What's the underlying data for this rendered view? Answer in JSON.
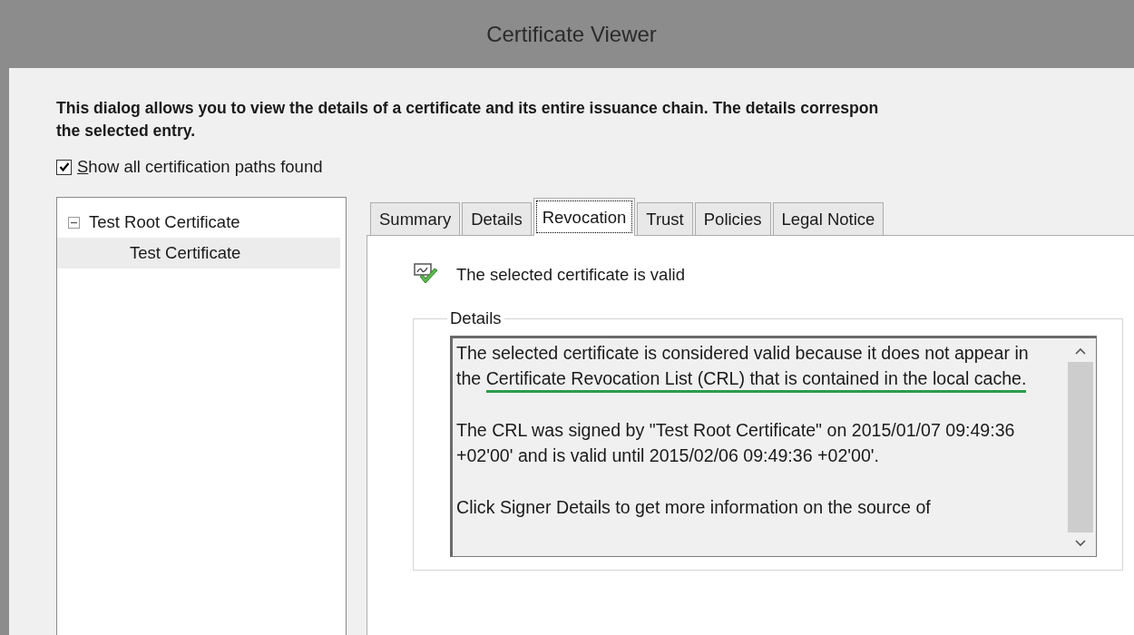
{
  "window": {
    "title": "Certificate Viewer"
  },
  "intro": [
    "This dialog allows you to view the details of a certificate and its entire issuance chain. The details correspon",
    "the selected entry."
  ],
  "show_all_paths": {
    "label": "Show all certification paths found",
    "checked": true
  },
  "tree": [
    {
      "label": "Test Root Certificate",
      "expanded": true,
      "selected": false,
      "children": [
        {
          "label": "Test Certificate",
          "selected": true
        }
      ]
    }
  ],
  "tabs": [
    {
      "label": "Summary",
      "selected": false
    },
    {
      "label": "Details",
      "selected": false
    },
    {
      "label": "Revocation",
      "selected": true
    },
    {
      "label": "Trust",
      "selected": false
    },
    {
      "label": "Policies",
      "selected": false
    },
    {
      "label": "Legal Notice",
      "selected": false
    }
  ],
  "status": {
    "text": "The selected certificate is valid"
  },
  "details": {
    "legend": "Details",
    "paragraphs": [
      {
        "segments": [
          {
            "text": "The selected certificate is considered valid because it does not appear in the ",
            "marked": false
          },
          {
            "text": "Certificate Revocation List (CRL) that is contained in the local cache.",
            "marked": true
          }
        ]
      },
      {
        "segments": [
          {
            "text": "The CRL was signed by \"Test Root Certificate\" on 2015/01/07 09:49:36 +02'00' and is valid until 2015/02/06 09:49:36 +02'00'.",
            "marked": false
          }
        ]
      },
      {
        "segments": [
          {
            "text": "Click Signer Details to get more information on the source of",
            "marked": false
          }
        ]
      }
    ]
  }
}
